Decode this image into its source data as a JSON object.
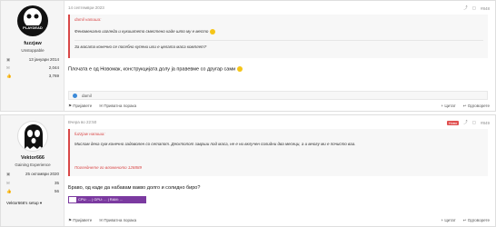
{
  "posts": [
    {
      "user": {
        "name": "fuzzjaw",
        "title": "Unstoppable",
        "stats": [
          {
            "icon": "calendar-icon",
            "value": "13 јануари 2014"
          },
          {
            "icon": "message-icon",
            "value": "2,044"
          },
          {
            "icon": "thumbs-up-icon",
            "value": "3,769"
          }
        ]
      },
      "date": "14 септември 2023",
      "post_number": "#848",
      "quote": {
        "author": "damil напиша:",
        "lines": [
          "Феноменално изгледа и кукиштето сместено каде што му е место",
          "За масата конечно се посебно купени или е целата маса комплет?"
        ]
      },
      "body": "Плочата е од Новомак, конструкцијата долу ја правевме со другар сами",
      "reactions": "damil",
      "actions": {
        "like": "Пријавете",
        "reply_private": "Приватна порака",
        "quote": "+ Цитат",
        "reply": "Одговорете"
      }
    },
    {
      "user": {
        "name": "Vektor666",
        "title": "Gaining Experience",
        "stats": [
          {
            "icon": "calendar-icon",
            "value": "25 октомври 2020"
          },
          {
            "icon": "message-icon",
            "value": "35"
          },
          {
            "icon": "thumbs-up-icon",
            "value": "56"
          }
        ],
        "setup": "Vektor666's setup"
      },
      "date": "Вчера во 22:50",
      "badge": "Ново",
      "post_number": "#849",
      "quote": {
        "author": "fuzzjaw напиша:",
        "lines": [
          "Мислам дека сум конечно задоволен со сетапот. Десктопот заврши под маса, не е ни вклучен солидни два месеци, а и многу ми е почисто ваа."
        ],
        "link": "Погледнете го вложеното 128889"
      },
      "body": "Браво, од каде да набавам вакво долго и солидно биро?",
      "signature": "CPU: ... | GPU: ... | RAM: ...",
      "actions": {
        "like": "Пријавете",
        "reply_private": "Приватна порака",
        "quote": "+ Цитат",
        "reply": "Одговорете"
      }
    }
  ]
}
